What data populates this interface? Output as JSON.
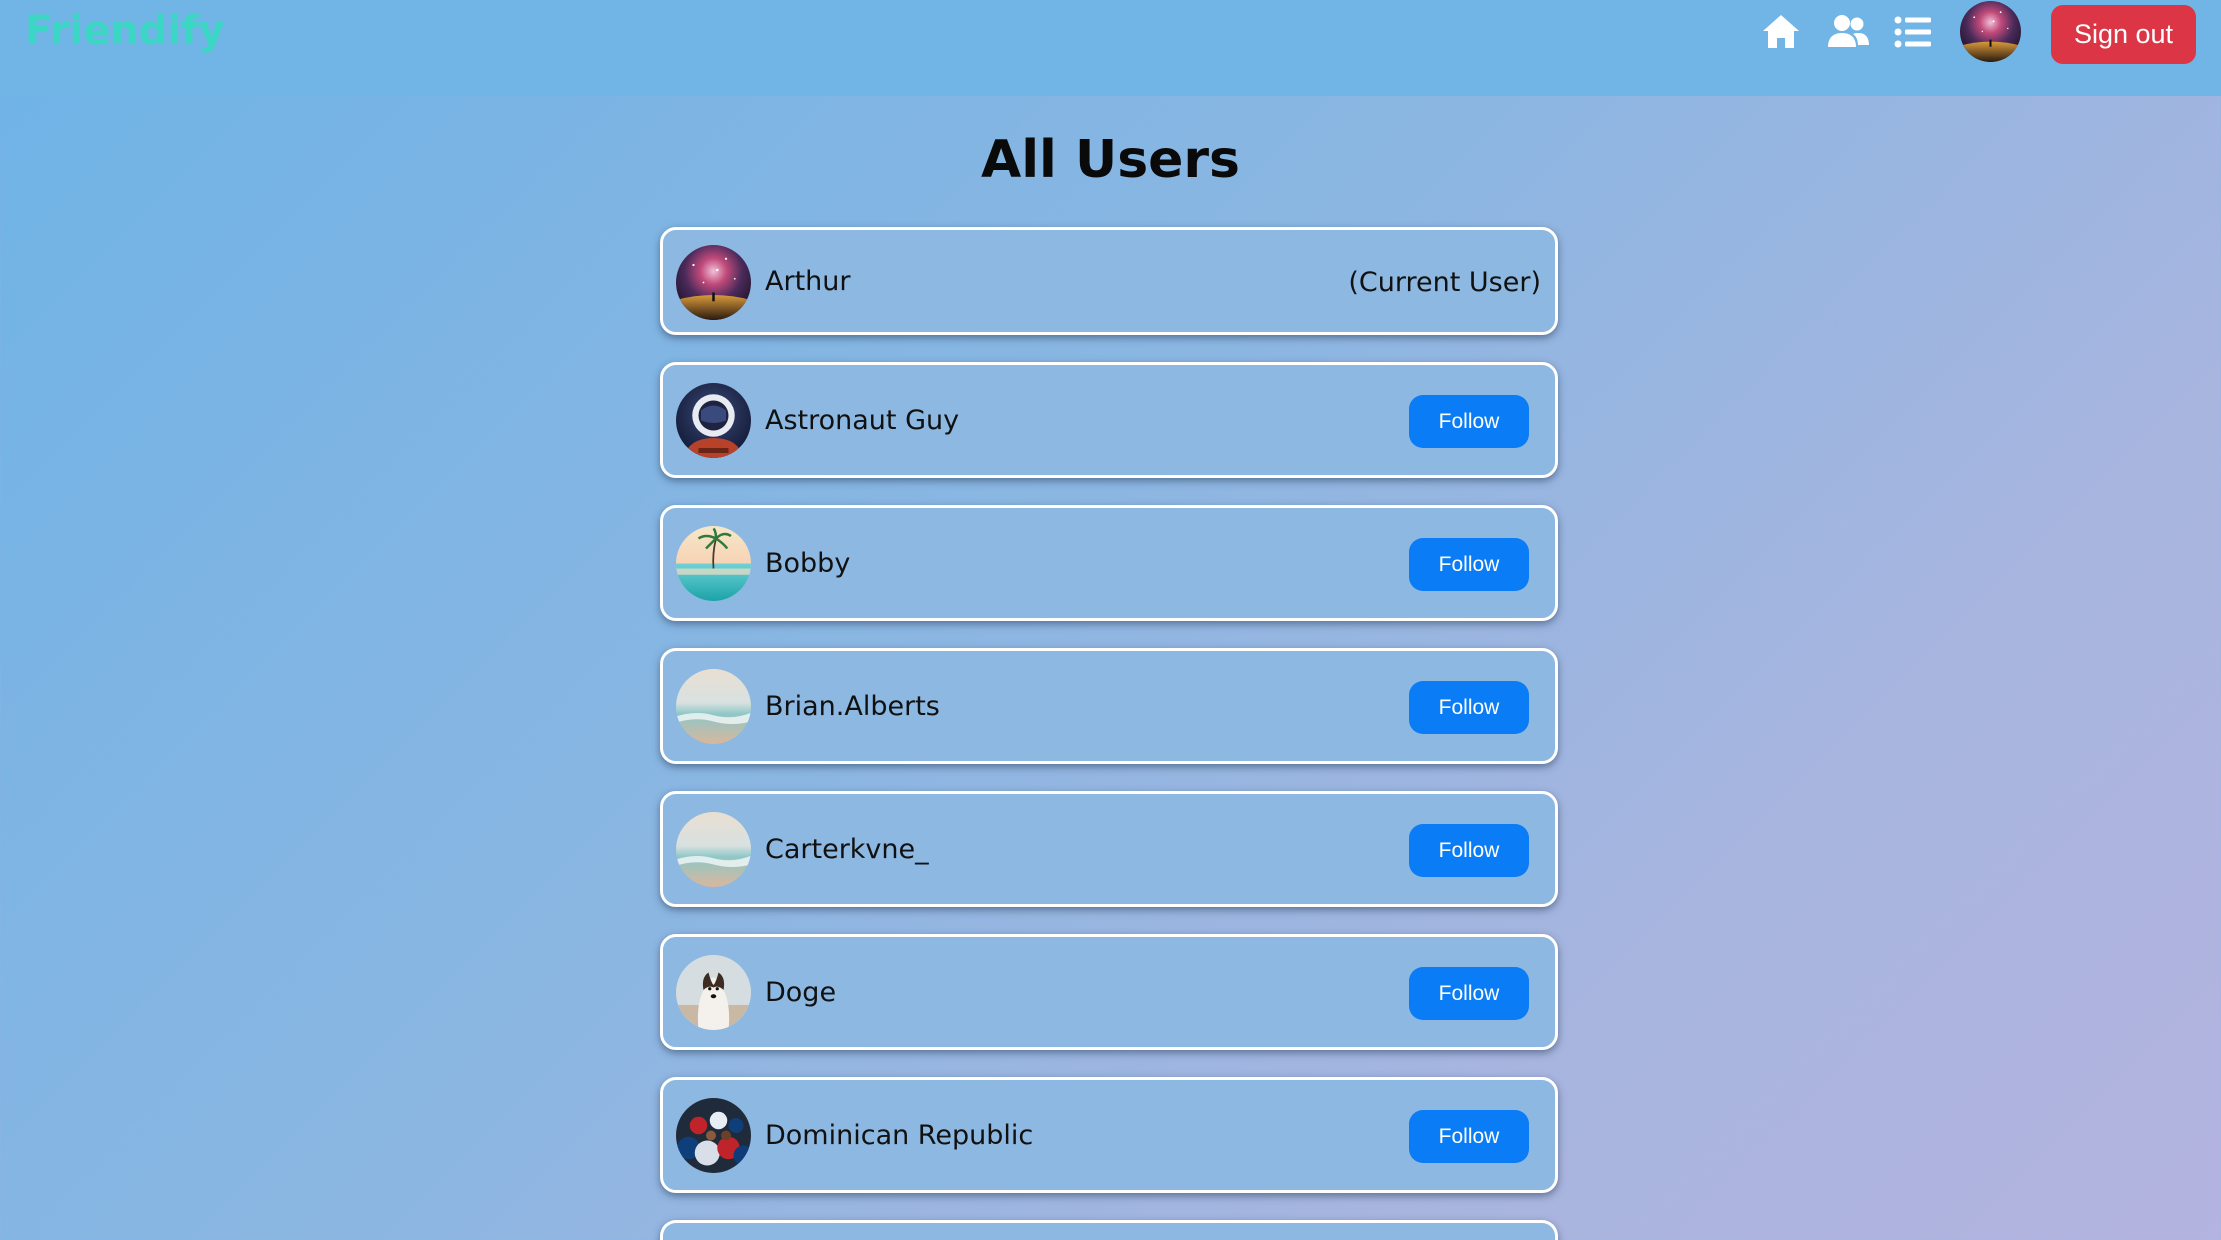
{
  "header": {
    "brand": "Friendify",
    "icons": [
      "home-icon",
      "users-icon",
      "list-icon"
    ],
    "signout_label": "Sign out"
  },
  "page": {
    "title": "All Users"
  },
  "users": [
    {
      "name": "Arthur",
      "tag": "(Current User)",
      "avatar": "galaxy-avatar"
    },
    {
      "name": "Astronaut Guy",
      "button": "Follow",
      "avatar": "astronaut-avatar"
    },
    {
      "name": "Bobby",
      "button": "Follow",
      "avatar": "palm-tree-avatar"
    },
    {
      "name": "Brian.Alberts",
      "button": "Follow",
      "avatar": "beach-avatar"
    },
    {
      "name": "Carterkvne_",
      "button": "Follow",
      "avatar": "beach-avatar"
    },
    {
      "name": "Doge",
      "button": "Follow",
      "avatar": "dog-avatar"
    },
    {
      "name": "Dominican Republic",
      "button": "Follow",
      "avatar": "crowd-avatar"
    }
  ],
  "colors": {
    "brand": "#3cd6c4",
    "header_bg": "#70b5e5",
    "signout": "#dc3545",
    "follow": "#0a7cf5"
  }
}
